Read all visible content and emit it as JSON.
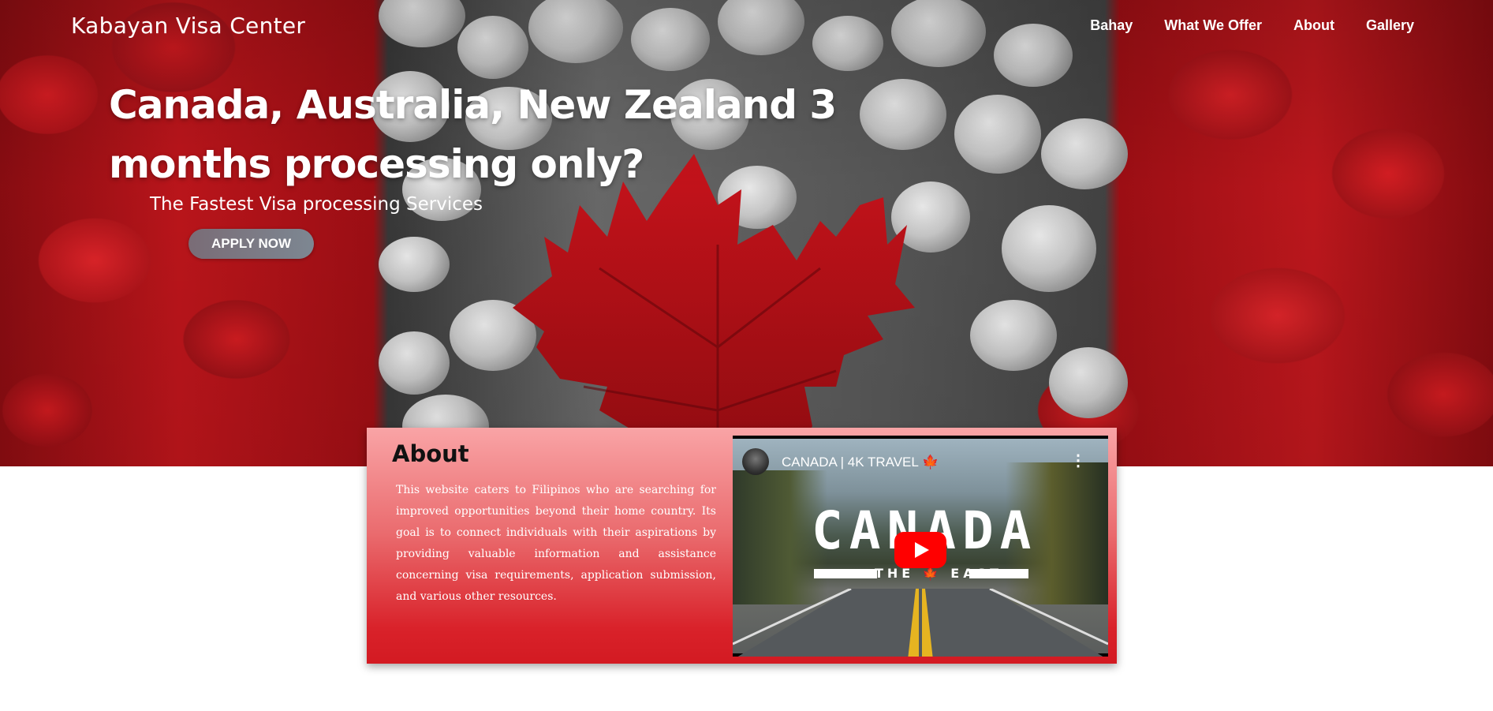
{
  "brand": {
    "name": "Kabayan Visa Center"
  },
  "nav": {
    "items": [
      {
        "label": "Bahay"
      },
      {
        "label": "What We Offer"
      },
      {
        "label": "About"
      },
      {
        "label": "Gallery"
      }
    ]
  },
  "hero": {
    "headline": "Canada, Australia, New Zealand 3 months processing only?",
    "tagline": "The Fastest Visa processing Services",
    "cta_label": "APPLY NOW"
  },
  "about": {
    "title": "About",
    "body": "This website caters to Filipinos who are searching for improved opportunities beyond their home country. Its goal is to connect individuals with their aspirations by providing valuable information and assistance concerning visa requirements, application submission, and various other resources."
  },
  "video": {
    "title": "CANADA | 4K TRAVEL 🍁",
    "thumbnail_word": "CANADA",
    "thumbnail_sub": "THE 🍁 EAST",
    "menu_icon": "more-vert-icon",
    "play_icon": "youtube-play-icon"
  },
  "colors": {
    "accent_red": "#d31a22",
    "card_top": "#f9a4a6",
    "button": "#7d8792"
  }
}
